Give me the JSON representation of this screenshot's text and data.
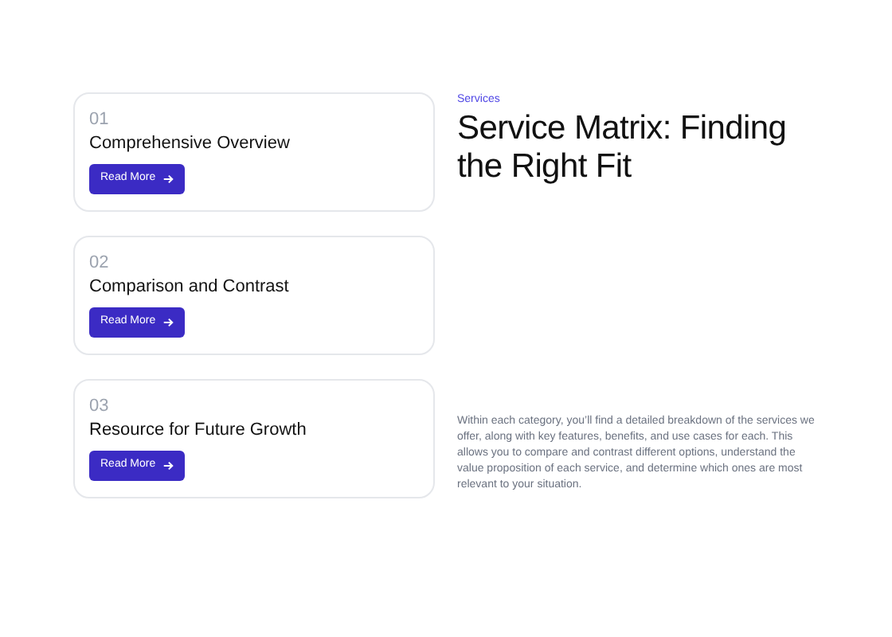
{
  "cards": [
    {
      "number": "01",
      "title": "Comprehensive Overview",
      "button": "Read More"
    },
    {
      "number": "02",
      "title": "Comparison and Contrast",
      "button": "Read More"
    },
    {
      "number": "03",
      "title": "Resource for Future Growth",
      "button": "Read More"
    }
  ],
  "eyebrow": "Services",
  "heading": "Service Matrix: Finding the Right Fit",
  "description": "Within each category, you’ll find a detailed breakdown of the services we offer, along with key features, benefits, and use cases for each. This allows you to compare and contrast different options, understand the value proposition of each service, and determine which ones are most relevant to your situation."
}
